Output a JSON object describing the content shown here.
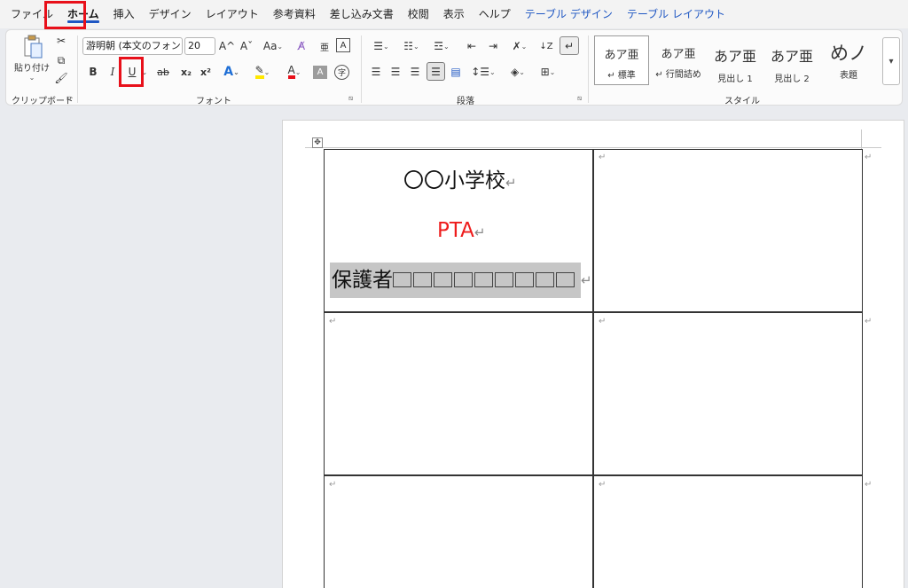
{
  "tabs": [
    {
      "label": "ファイル",
      "style": "normal"
    },
    {
      "label": "ホーム",
      "style": "active"
    },
    {
      "label": "挿入",
      "style": "normal"
    },
    {
      "label": "デザイン",
      "style": "normal"
    },
    {
      "label": "レイアウト",
      "style": "normal"
    },
    {
      "label": "参考資料",
      "style": "normal"
    },
    {
      "label": "差し込み文書",
      "style": "normal"
    },
    {
      "label": "校閲",
      "style": "normal"
    },
    {
      "label": "表示",
      "style": "normal"
    },
    {
      "label": "ヘルプ",
      "style": "normal"
    },
    {
      "label": "テーブル デザイン",
      "style": "blue"
    },
    {
      "label": "テーブル レイアウト",
      "style": "blue"
    }
  ],
  "clipboard": {
    "paste_label": "貼り付け",
    "group_label": "クリップボード"
  },
  "font": {
    "font_name": "游明朝 (本文のフォント",
    "font_size": "20",
    "group_label": "フォント",
    "bold": "B",
    "italic": "I",
    "underline": "U",
    "strike": "ab",
    "subscript": "x₂",
    "superscript": "x²",
    "text_effect": "A",
    "font_color": "A",
    "grow": "A^",
    "shrink": "Aˇ",
    "case": "Aa",
    "char_shade": "A",
    "char_border": "A",
    "enclose": "字",
    "phonetic": "亜"
  },
  "paragraph": {
    "group_label": "段落"
  },
  "styles": {
    "group_label": "スタイル",
    "items": [
      {
        "sample": "あア亜",
        "label": "↵ 標準"
      },
      {
        "sample": "あア亜",
        "label": "↵ 行間詰め"
      },
      {
        "sample": "あア亜",
        "label": "見出し 1"
      },
      {
        "sample": "あア亜",
        "label": "見出し 2"
      },
      {
        "sample": "めノ",
        "label": "表題"
      }
    ]
  },
  "document": {
    "school": "〇〇小学校",
    "pta": "PTA",
    "guardian": "保護者"
  },
  "colors": {
    "accent": "#1f57c3",
    "highlight_red": "#e8101a",
    "pta_text": "#ee1c1c",
    "selection": "#c6c6c6"
  }
}
